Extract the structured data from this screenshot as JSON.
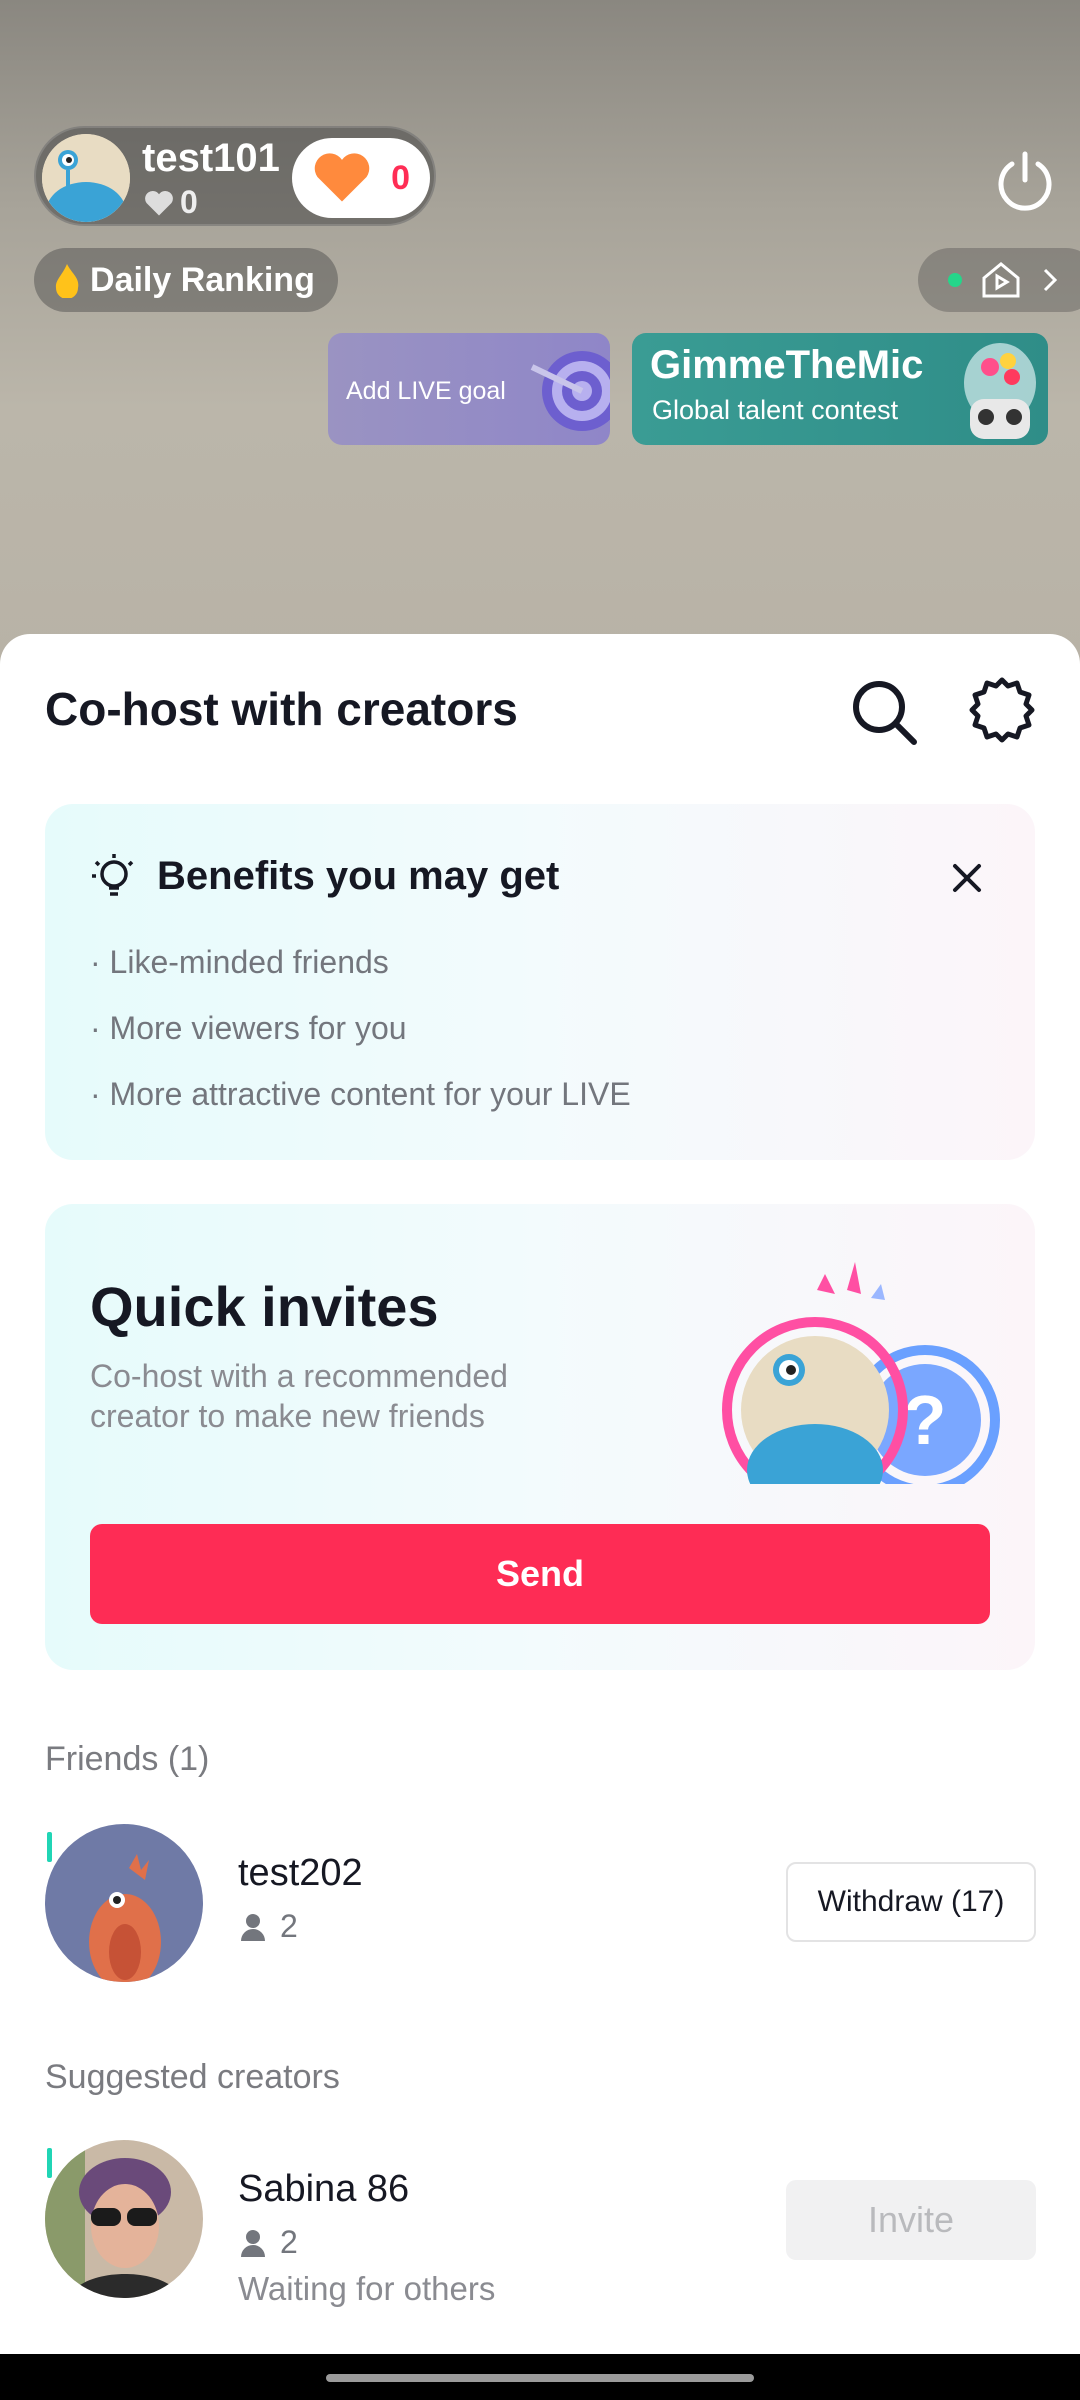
{
  "header": {
    "host_name": "test101",
    "host_likes": "0",
    "like_count": "0",
    "ranking_label": "Daily Ranking"
  },
  "banners": {
    "goal_label": "Add LIVE goal",
    "talent_title": "GimmeTheMic",
    "talent_subtitle": "Global talent contest"
  },
  "sheet": {
    "title": "Co-host with creators",
    "benefits": {
      "title": "Benefits you may get",
      "items": [
        "· Like-minded friends",
        "· More viewers for you",
        "· More attractive content for your LIVE"
      ]
    },
    "quick_invites": {
      "title": "Quick invites",
      "subtitle": "Co-host with a recommended creator to make new friends",
      "send_label": "Send"
    },
    "friends": {
      "label": "Friends (1)",
      "items": [
        {
          "name": "test202",
          "count": "2",
          "action": "Withdraw (17)"
        }
      ]
    },
    "suggested": {
      "label": "Suggested creators",
      "items": [
        {
          "name": "Sabina 86",
          "count": "2",
          "status": "Waiting for others",
          "action": "Invite"
        }
      ]
    }
  },
  "colors": {
    "accent": "#fe2c55",
    "online": "#25d58a",
    "row_accent": "#20d5b5"
  },
  "icons": [
    "heart-icon",
    "power-icon",
    "fire-icon",
    "home-icon",
    "chevron-right-icon",
    "search-icon",
    "gear-icon",
    "bulb-icon",
    "close-icon",
    "person-icon"
  ]
}
